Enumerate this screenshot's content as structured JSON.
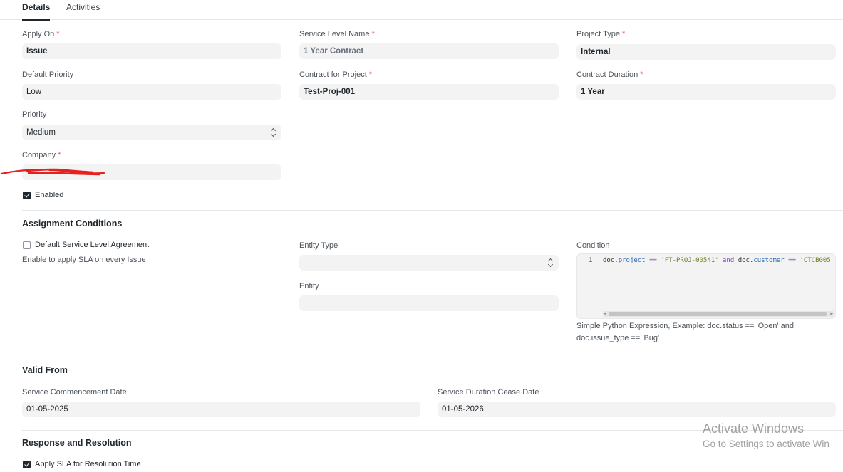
{
  "tabs": [
    {
      "label": "Details"
    },
    {
      "label": "Activities"
    }
  ],
  "details": {
    "apply_on": {
      "label": "Apply On",
      "value": "Issue"
    },
    "service_level_name": {
      "label": "Service Level Name",
      "value": "1 Year Contract"
    },
    "project_type": {
      "label": "Project Type",
      "value": "Internal"
    },
    "default_priority": {
      "label": "Default Priority",
      "value": "Low"
    },
    "contract_for_project": {
      "label": "Contract for Project",
      "value": "Test-Proj-001"
    },
    "contract_duration": {
      "label": "Contract Duration",
      "value": "1 Year"
    },
    "priority": {
      "label": "Priority",
      "value": "Medium"
    },
    "company": {
      "label": "Company",
      "value": ""
    },
    "enabled": {
      "label": "Enabled",
      "checked": true
    }
  },
  "assignment": {
    "title": "Assignment Conditions",
    "default_sla": {
      "label": "Default Service Level Agreement",
      "checked": false
    },
    "default_sla_desc": "Enable to apply SLA on every Issue",
    "entity_type": {
      "label": "Entity Type",
      "value": ""
    },
    "entity": {
      "label": "Entity",
      "value": ""
    },
    "condition": {
      "label": "Condition",
      "line_number": "1",
      "code": {
        "t1": "doc.",
        "t2": "project",
        "t3": " == ",
        "t4": "'FT-PROJ-00541'",
        "t5": " and ",
        "t6": "doc.",
        "t7": "customer",
        "t8": " == ",
        "t9": "'CTCB005"
      },
      "help_line1": "Simple Python Expression, Example: doc.status == 'Open' and",
      "help_line2": "doc.issue_type == 'Bug'"
    }
  },
  "valid_from": {
    "title": "Valid From",
    "commencement": {
      "label": "Service Commencement Date",
      "value": "01-05-2025"
    },
    "cease": {
      "label": "Service Duration Cease Date",
      "value": "01-05-2026"
    }
  },
  "response": {
    "title": "Response and Resolution",
    "apply_sla": {
      "label": "Apply SLA for Resolution Time",
      "checked": true
    }
  },
  "watermark": {
    "line1": "Activate Windows",
    "line2": "Go to Settings to activate Win"
  },
  "colors": {
    "required": "#e24c4c",
    "field_bg": "#f3f3f3",
    "redaction": "#e8201c"
  },
  "icons": {
    "select": "updown-chevron-icon",
    "checkbox": "checkmark-icon"
  }
}
